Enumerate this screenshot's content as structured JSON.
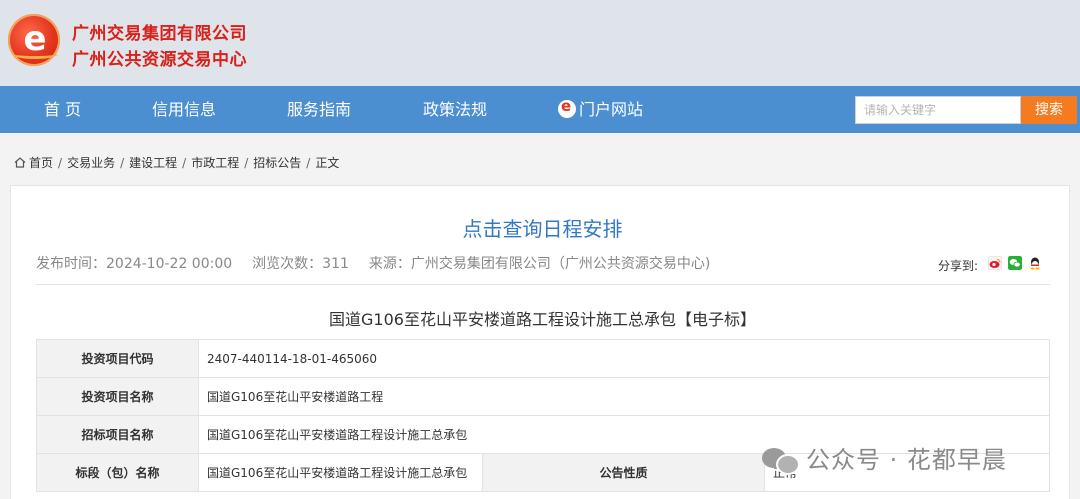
{
  "header": {
    "org_name_1": "广州交易集团有限公司",
    "org_name_2": "广州公共资源交易中心"
  },
  "nav": {
    "items": [
      "首 页",
      "信用信息",
      "服务指南",
      "政策法规",
      "门户网站"
    ],
    "search_placeholder": "请输入关键字",
    "search_button": "搜索"
  },
  "breadcrumb": [
    "首页",
    "交易业务",
    "建设工程",
    "市政工程",
    "招标公告",
    "正文"
  ],
  "article": {
    "schedule_link": "点击查询日程安排",
    "publish_time": "发布时间：2024-10-22 00:00",
    "views": "浏览次数：311",
    "source": "来源：广州交易集团有限公司（广州公共资源交易中心)",
    "share_label": "分享到:",
    "share_icons": [
      "weibo-icon",
      "wechat-icon",
      "qq-icon"
    ],
    "title": "国道G106至花山平安楼道路工程设计施工总承包【电子标】"
  },
  "table": {
    "rows": [
      {
        "label": "投资项目代码",
        "value": "2407-440114-18-01-465060"
      },
      {
        "label": "投资项目名称",
        "value": "国道G106至花山平安楼道路工程"
      },
      {
        "label": "招标项目名称",
        "value": "国道G106至花山平安楼道路工程设计施工总承包"
      }
    ],
    "last_row": {
      "label": "标段（包）名称",
      "value": "国道G106至花山平安楼道路工程设计施工总承包",
      "label2": "公告性质",
      "value2": "正常"
    }
  },
  "watermark": "公众号 · 花都早晨",
  "colors": {
    "nav_bg": "#4b8fd1",
    "brand_red": "#d8211a",
    "search_orange": "#f47b20",
    "link_blue": "#3278c8"
  }
}
